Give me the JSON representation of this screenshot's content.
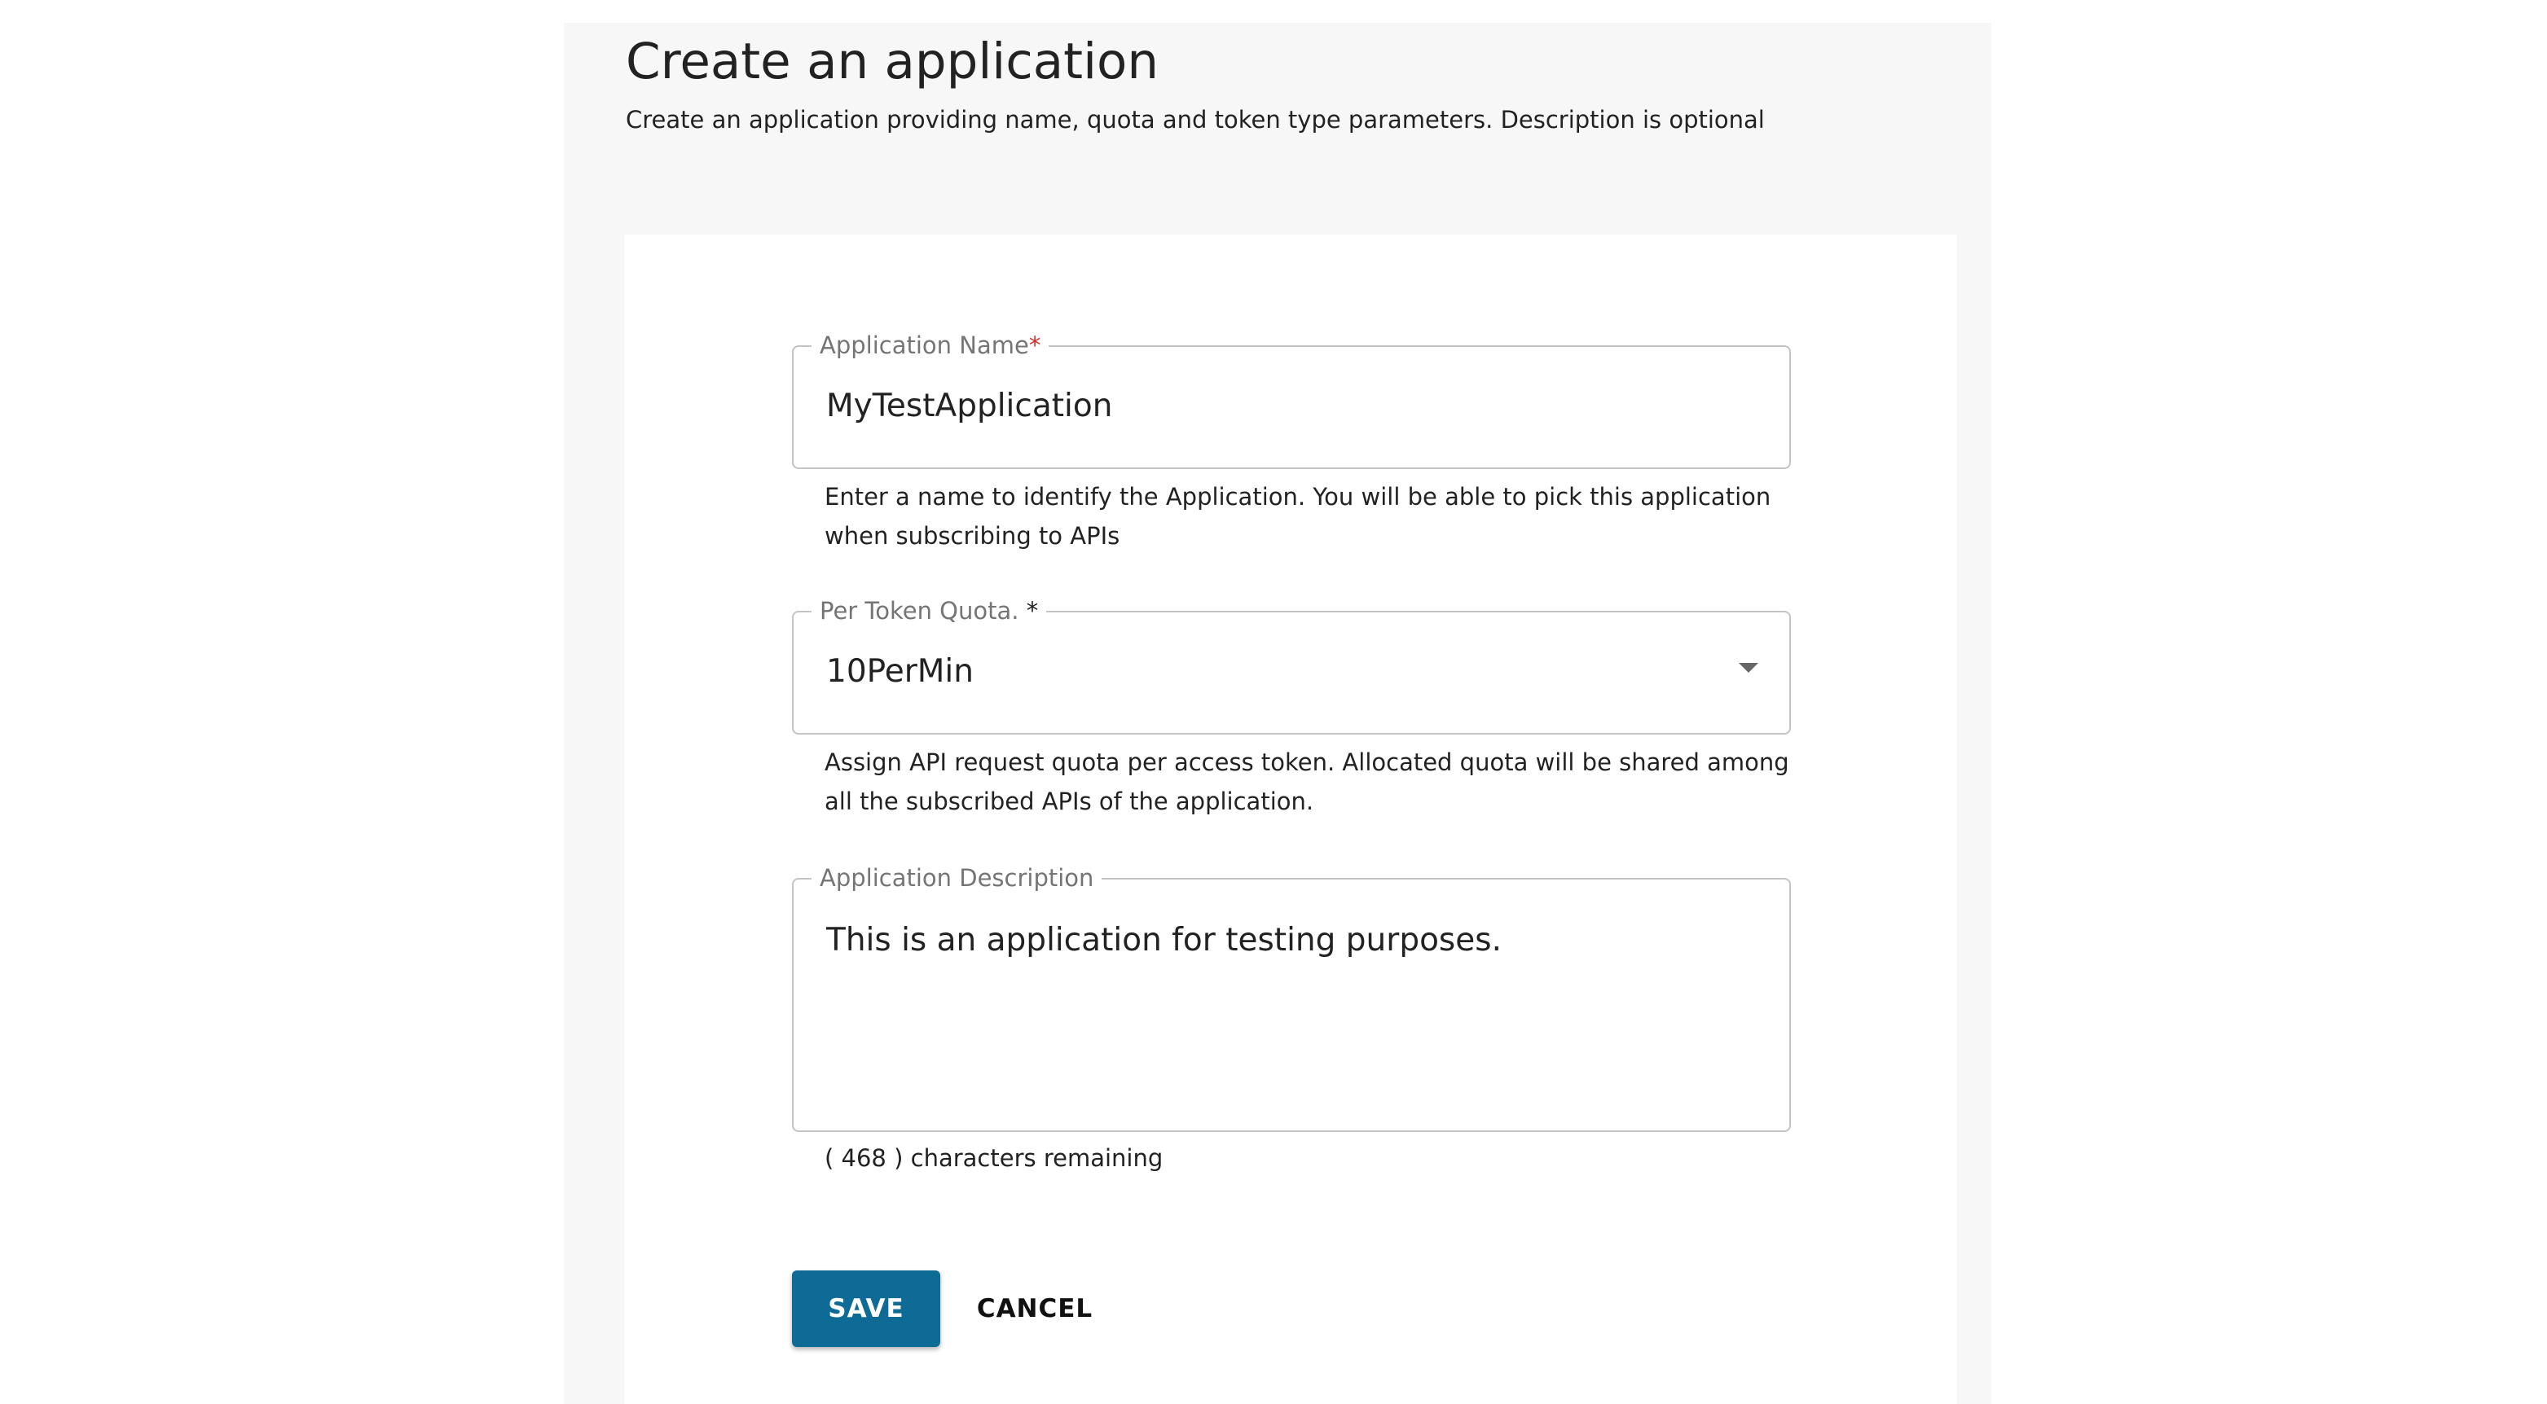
{
  "header": {
    "title": "Create an application",
    "subtitle": "Create an application providing name, quota and token type parameters. Description is optional"
  },
  "form": {
    "app_name": {
      "label": "Application Name",
      "required_mark": "*",
      "value": "MyTestApplication",
      "helper": "Enter a name to identify the Application. You will be able to pick this application when subscribing to APIs"
    },
    "quota": {
      "label": "Per Token Quota.",
      "required_mark": "*",
      "value": "10PerMin",
      "helper": "Assign API request quota per access token. Allocated quota will be shared among all the subscribed APIs of the application."
    },
    "description": {
      "label": "Application Description",
      "value": "This is an application for testing purposes.",
      "remaining": "( 468 ) characters remaining"
    }
  },
  "actions": {
    "save_label": "SAVE",
    "cancel_label": "CANCEL"
  },
  "colors": {
    "primary": "#0d6b96",
    "required": "#d32f2f",
    "panel_bg": "#f7f7f7",
    "border": "#c4c4c4"
  },
  "icons": {
    "quota_dropdown": "chevron-down-icon"
  }
}
